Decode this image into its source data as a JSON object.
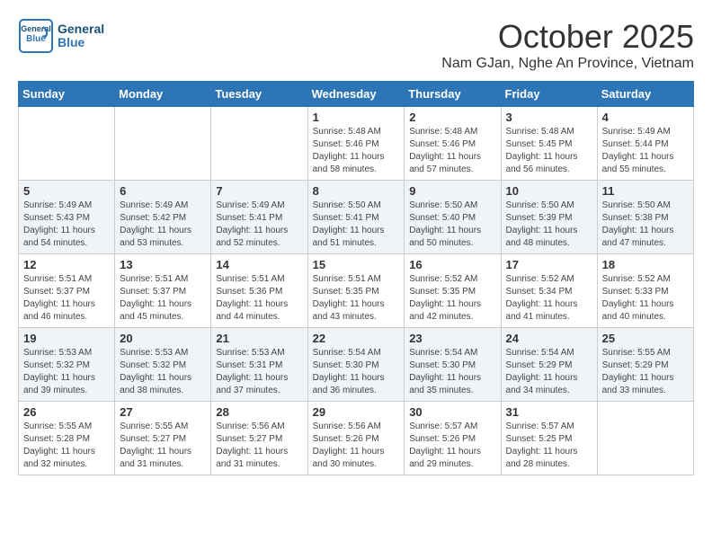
{
  "header": {
    "logo_line1": "General",
    "logo_line2": "Blue",
    "month": "October 2025",
    "location": "Nam GJan, Nghe An Province, Vietnam"
  },
  "days_of_week": [
    "Sunday",
    "Monday",
    "Tuesday",
    "Wednesday",
    "Thursday",
    "Friday",
    "Saturday"
  ],
  "weeks": [
    [
      {
        "day": "",
        "info": ""
      },
      {
        "day": "",
        "info": ""
      },
      {
        "day": "",
        "info": ""
      },
      {
        "day": "1",
        "info": "Sunrise: 5:48 AM\nSunset: 5:46 PM\nDaylight: 11 hours\nand 58 minutes."
      },
      {
        "day": "2",
        "info": "Sunrise: 5:48 AM\nSunset: 5:46 PM\nDaylight: 11 hours\nand 57 minutes."
      },
      {
        "day": "3",
        "info": "Sunrise: 5:48 AM\nSunset: 5:45 PM\nDaylight: 11 hours\nand 56 minutes."
      },
      {
        "day": "4",
        "info": "Sunrise: 5:49 AM\nSunset: 5:44 PM\nDaylight: 11 hours\nand 55 minutes."
      }
    ],
    [
      {
        "day": "5",
        "info": "Sunrise: 5:49 AM\nSunset: 5:43 PM\nDaylight: 11 hours\nand 54 minutes."
      },
      {
        "day": "6",
        "info": "Sunrise: 5:49 AM\nSunset: 5:42 PM\nDaylight: 11 hours\nand 53 minutes."
      },
      {
        "day": "7",
        "info": "Sunrise: 5:49 AM\nSunset: 5:41 PM\nDaylight: 11 hours\nand 52 minutes."
      },
      {
        "day": "8",
        "info": "Sunrise: 5:50 AM\nSunset: 5:41 PM\nDaylight: 11 hours\nand 51 minutes."
      },
      {
        "day": "9",
        "info": "Sunrise: 5:50 AM\nSunset: 5:40 PM\nDaylight: 11 hours\nand 50 minutes."
      },
      {
        "day": "10",
        "info": "Sunrise: 5:50 AM\nSunset: 5:39 PM\nDaylight: 11 hours\nand 48 minutes."
      },
      {
        "day": "11",
        "info": "Sunrise: 5:50 AM\nSunset: 5:38 PM\nDaylight: 11 hours\nand 47 minutes."
      }
    ],
    [
      {
        "day": "12",
        "info": "Sunrise: 5:51 AM\nSunset: 5:37 PM\nDaylight: 11 hours\nand 46 minutes."
      },
      {
        "day": "13",
        "info": "Sunrise: 5:51 AM\nSunset: 5:37 PM\nDaylight: 11 hours\nand 45 minutes."
      },
      {
        "day": "14",
        "info": "Sunrise: 5:51 AM\nSunset: 5:36 PM\nDaylight: 11 hours\nand 44 minutes."
      },
      {
        "day": "15",
        "info": "Sunrise: 5:51 AM\nSunset: 5:35 PM\nDaylight: 11 hours\nand 43 minutes."
      },
      {
        "day": "16",
        "info": "Sunrise: 5:52 AM\nSunset: 5:35 PM\nDaylight: 11 hours\nand 42 minutes."
      },
      {
        "day": "17",
        "info": "Sunrise: 5:52 AM\nSunset: 5:34 PM\nDaylight: 11 hours\nand 41 minutes."
      },
      {
        "day": "18",
        "info": "Sunrise: 5:52 AM\nSunset: 5:33 PM\nDaylight: 11 hours\nand 40 minutes."
      }
    ],
    [
      {
        "day": "19",
        "info": "Sunrise: 5:53 AM\nSunset: 5:32 PM\nDaylight: 11 hours\nand 39 minutes."
      },
      {
        "day": "20",
        "info": "Sunrise: 5:53 AM\nSunset: 5:32 PM\nDaylight: 11 hours\nand 38 minutes."
      },
      {
        "day": "21",
        "info": "Sunrise: 5:53 AM\nSunset: 5:31 PM\nDaylight: 11 hours\nand 37 minutes."
      },
      {
        "day": "22",
        "info": "Sunrise: 5:54 AM\nSunset: 5:30 PM\nDaylight: 11 hours\nand 36 minutes."
      },
      {
        "day": "23",
        "info": "Sunrise: 5:54 AM\nSunset: 5:30 PM\nDaylight: 11 hours\nand 35 minutes."
      },
      {
        "day": "24",
        "info": "Sunrise: 5:54 AM\nSunset: 5:29 PM\nDaylight: 11 hours\nand 34 minutes."
      },
      {
        "day": "25",
        "info": "Sunrise: 5:55 AM\nSunset: 5:29 PM\nDaylight: 11 hours\nand 33 minutes."
      }
    ],
    [
      {
        "day": "26",
        "info": "Sunrise: 5:55 AM\nSunset: 5:28 PM\nDaylight: 11 hours\nand 32 minutes."
      },
      {
        "day": "27",
        "info": "Sunrise: 5:55 AM\nSunset: 5:27 PM\nDaylight: 11 hours\nand 31 minutes."
      },
      {
        "day": "28",
        "info": "Sunrise: 5:56 AM\nSunset: 5:27 PM\nDaylight: 11 hours\nand 31 minutes."
      },
      {
        "day": "29",
        "info": "Sunrise: 5:56 AM\nSunset: 5:26 PM\nDaylight: 11 hours\nand 30 minutes."
      },
      {
        "day": "30",
        "info": "Sunrise: 5:57 AM\nSunset: 5:26 PM\nDaylight: 11 hours\nand 29 minutes."
      },
      {
        "day": "31",
        "info": "Sunrise: 5:57 AM\nSunset: 5:25 PM\nDaylight: 11 hours\nand 28 minutes."
      },
      {
        "day": "",
        "info": ""
      }
    ]
  ]
}
